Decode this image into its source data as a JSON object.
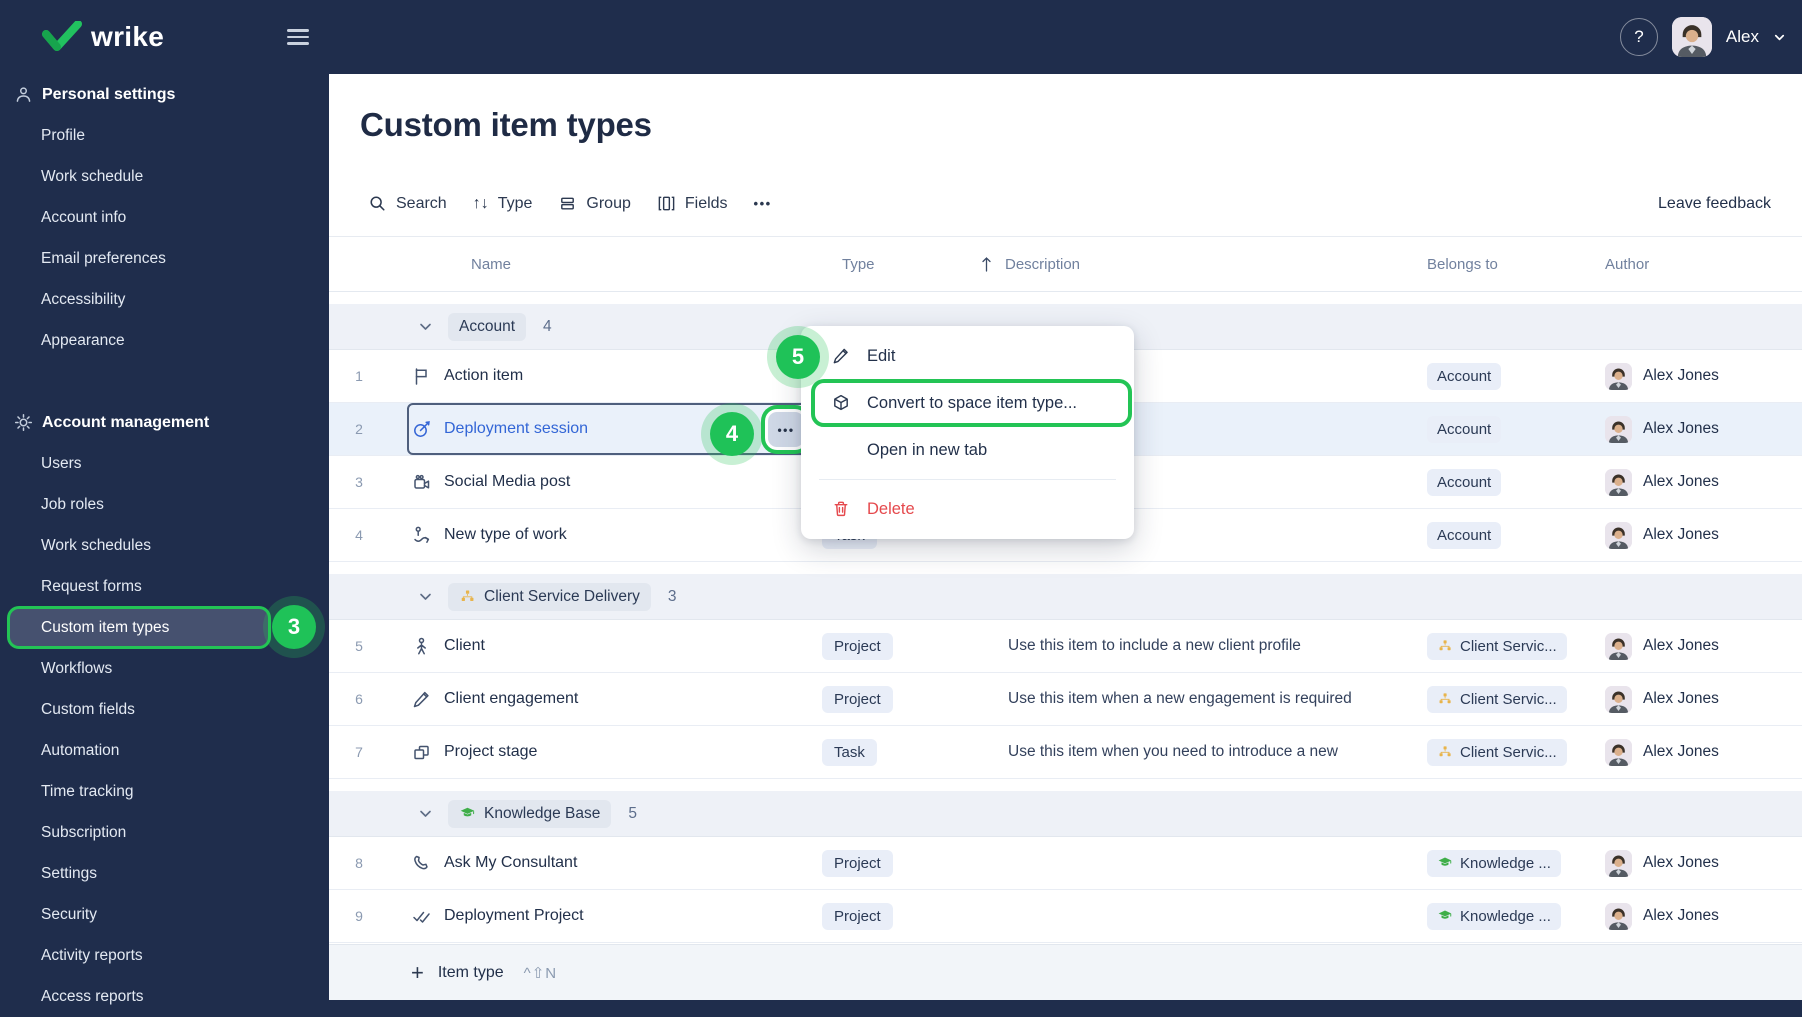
{
  "icons": {
    "help": "?",
    "more": "•••",
    "row_more": "•••",
    "sort": "↑↓",
    "plus": "+"
  },
  "topbar": {
    "brand": "wrike",
    "user": {
      "name": "Alex"
    }
  },
  "sidebar": {
    "sections": [
      {
        "title": "Personal settings",
        "items": [
          {
            "label": "Profile"
          },
          {
            "label": "Work schedule"
          },
          {
            "label": "Account info"
          },
          {
            "label": "Email preferences"
          },
          {
            "label": "Accessibility"
          },
          {
            "label": "Appearance"
          }
        ]
      },
      {
        "title": "Account management",
        "items": [
          {
            "label": "Users"
          },
          {
            "label": "Job roles"
          },
          {
            "label": "Work schedules"
          },
          {
            "label": "Request forms"
          },
          {
            "label": "Custom item types",
            "active": true
          },
          {
            "label": "Workflows"
          },
          {
            "label": "Custom fields"
          },
          {
            "label": "Automation"
          },
          {
            "label": "Time tracking"
          },
          {
            "label": "Subscription"
          },
          {
            "label": "Settings"
          },
          {
            "label": "Security"
          },
          {
            "label": "Activity reports"
          },
          {
            "label": "Access reports"
          }
        ]
      }
    ]
  },
  "annotations": {
    "step3": "3",
    "step4": "4",
    "step5": "5"
  },
  "main": {
    "title": "Custom item types",
    "toolbar": {
      "search": "Search",
      "type": "Type",
      "group": "Group",
      "fields": "Fields",
      "leave_feedback": "Leave feedback"
    },
    "table": {
      "headers": {
        "name": "Name",
        "type": "Type",
        "description": "Description",
        "belongs_to": "Belongs to",
        "author": "Author"
      },
      "groups": [
        {
          "label": "Account",
          "count": "4",
          "rows": [
            {
              "num": "1",
              "icon": "flag-icon",
              "name": "Action item",
              "type": "",
              "description": "",
              "belongs_to": "Account",
              "author": "Alex Jones"
            },
            {
              "num": "2",
              "icon": "dart-icon",
              "name": "Deployment session",
              "type": "",
              "description": "",
              "belongs_to": "Account",
              "author": "Alex Jones",
              "selected": true
            },
            {
              "num": "3",
              "icon": "video-camera-icon",
              "name": "Social Media post",
              "type": "",
              "description": "",
              "belongs_to": "Account",
              "author": "Alex Jones"
            },
            {
              "num": "4",
              "icon": "route-icon",
              "name": "New type of work",
              "type": "Task",
              "description": "",
              "belongs_to": "Account",
              "author": "Alex Jones"
            }
          ]
        },
        {
          "label": "Client Service Delivery",
          "count": "3",
          "rows": [
            {
              "num": "5",
              "icon": "person-icon",
              "name": "Client",
              "type": "Project",
              "description": "Use this item to include a new client profile",
              "belongs_to": "Client Servic...",
              "author": "Alex Jones"
            },
            {
              "num": "6",
              "icon": "pencil-icon",
              "name": "Client engagement",
              "type": "Project",
              "description": "Use this item when a new engagement is required",
              "belongs_to": "Client Servic...",
              "author": "Alex Jones"
            },
            {
              "num": "7",
              "icon": "stages-icon",
              "name": "Project stage",
              "type": "Task",
              "description": "Use this item when you need to introduce a new",
              "belongs_to": "Client Servic...",
              "author": "Alex Jones"
            }
          ]
        },
        {
          "label": "Knowledge Base",
          "count": "5",
          "rows": [
            {
              "num": "8",
              "icon": "phone-icon",
              "name": "Ask My Consultant",
              "type": "Project",
              "description": "",
              "belongs_to": "Knowledge ...",
              "author": "Alex Jones"
            },
            {
              "num": "9",
              "icon": "double-check-icon",
              "name": "Deployment Project",
              "type": "Project",
              "description": "",
              "belongs_to": "Knowledge ...",
              "author": "Alex Jones"
            }
          ]
        }
      ],
      "footer": {
        "label": "Item type",
        "shortcut": "^⇧N"
      }
    },
    "context_menu": {
      "items": [
        {
          "label": "Edit"
        },
        {
          "label": "Convert to space item type..."
        },
        {
          "label": "Open in new tab"
        },
        {
          "label": "Delete"
        }
      ]
    }
  },
  "colors": {
    "navy": "#1f2d4c",
    "green": "#23c455",
    "link_blue": "#3366d6",
    "danger_red": "#e5494d"
  }
}
